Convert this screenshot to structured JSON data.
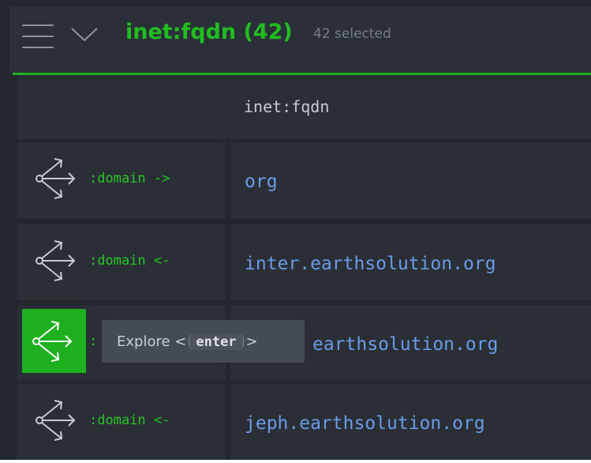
{
  "header": {
    "title": "inet:fqdn (42)",
    "selected": "42 selected"
  },
  "table": {
    "column": "inet:fqdn",
    "rows": [
      {
        "relation": ":domain ->",
        "value": "org"
      },
      {
        "relation": ":domain <-",
        "value": "inter.earthsolution.org"
      },
      {
        "relation": ":",
        "value": "earthsolution.org"
      },
      {
        "relation": ":domain <-",
        "value": "jeph.earthsolution.org"
      }
    ]
  },
  "tooltip": {
    "prefix": "Explore <",
    "key": "enter",
    "suffix": ">"
  },
  "colors": {
    "accent": "#1fbd1f",
    "link": "#6a9be8",
    "background": "#22262d"
  }
}
